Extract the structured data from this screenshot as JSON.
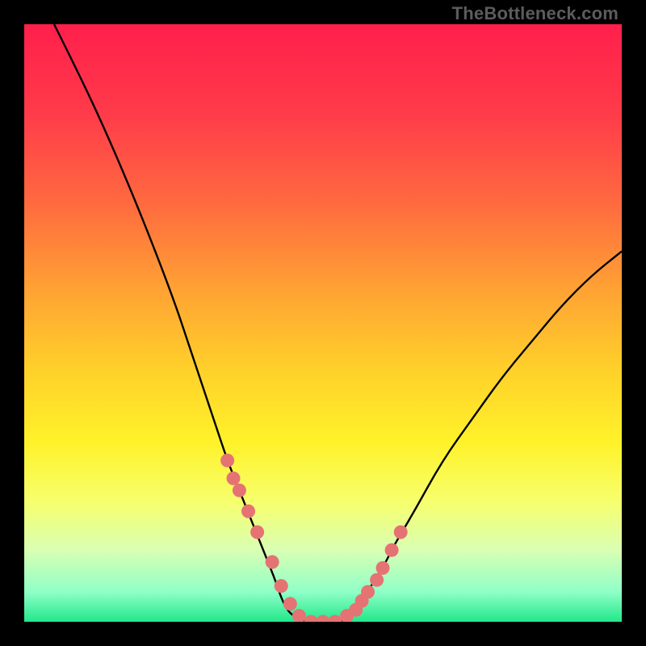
{
  "watermark": "TheBottleneck.com",
  "gradient": {
    "stops": [
      {
        "offset": 0.0,
        "color": "#ff1f4b"
      },
      {
        "offset": 0.15,
        "color": "#ff3b4a"
      },
      {
        "offset": 0.3,
        "color": "#ff6a3f"
      },
      {
        "offset": 0.45,
        "color": "#ffa433"
      },
      {
        "offset": 0.58,
        "color": "#ffd12a"
      },
      {
        "offset": 0.7,
        "color": "#fff22a"
      },
      {
        "offset": 0.8,
        "color": "#f6ff6e"
      },
      {
        "offset": 0.88,
        "color": "#d9ffb3"
      },
      {
        "offset": 0.95,
        "color": "#8fffc7"
      },
      {
        "offset": 1.0,
        "color": "#20e88a"
      }
    ]
  },
  "chart_data": {
    "type": "line",
    "title": "",
    "xlabel": "",
    "ylabel": "",
    "xlim": [
      0,
      100
    ],
    "ylim": [
      0,
      100
    ],
    "series": [
      {
        "name": "curve",
        "x": [
          5,
          10,
          15,
          20,
          25,
          28,
          30,
          32,
          34,
          36,
          38,
          40,
          42,
          43,
          44,
          45,
          47,
          50,
          53,
          55,
          56,
          57,
          58,
          60,
          62,
          65,
          70,
          75,
          80,
          85,
          90,
          95,
          100
        ],
        "values": [
          100,
          90,
          79,
          67,
          54,
          45,
          39,
          33,
          27,
          22,
          17,
          12,
          7,
          4,
          2,
          1,
          0,
          0,
          0,
          1,
          2,
          4,
          6,
          9,
          13,
          18,
          27,
          34,
          41,
          47,
          53,
          58,
          62
        ]
      }
    ],
    "markers": {
      "name": "dots",
      "color": "#e57373",
      "x": [
        34,
        35,
        36,
        37.5,
        39,
        41.5,
        43,
        44.5,
        46,
        48,
        50,
        52,
        54,
        55.5,
        56.5,
        57.5,
        59,
        60,
        61.5,
        63
      ],
      "values": [
        27,
        24,
        22,
        18.5,
        15,
        10,
        6,
        3,
        1,
        0,
        0,
        0,
        1,
        2,
        3.5,
        5,
        7,
        9,
        12,
        15
      ]
    }
  }
}
